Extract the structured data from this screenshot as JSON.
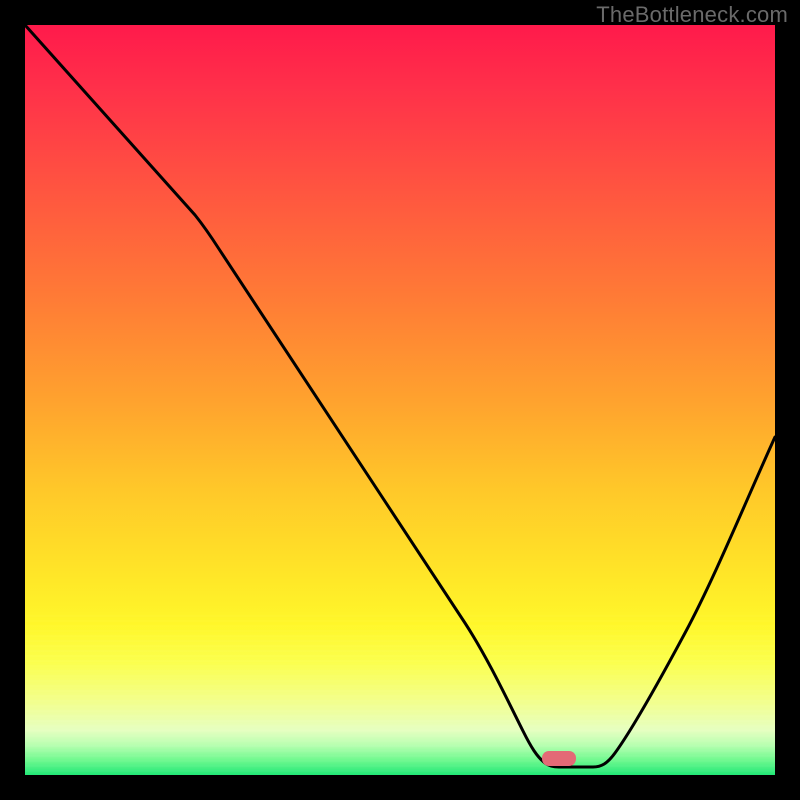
{
  "watermark": {
    "text": "TheBottleneck.com"
  },
  "chart_data": {
    "type": "line",
    "title": "",
    "xlabel": "",
    "ylabel": "",
    "xlim": [
      0,
      100
    ],
    "ylim": [
      0,
      100
    ],
    "x": [
      0,
      12,
      23,
      30,
      40,
      50,
      60,
      64,
      68,
      72,
      76,
      80,
      85,
      90,
      95,
      100
    ],
    "values": [
      100,
      86,
      75,
      68,
      55,
      42,
      27,
      17,
      8,
      3,
      1,
      2,
      9,
      22,
      38,
      56
    ],
    "gradient_colors": {
      "top": "#ff1a4b",
      "mid_upper": "#ff7a36",
      "mid": "#ffc829",
      "mid_lower": "#f3ff8a",
      "bottom": "#22e877"
    },
    "marker": {
      "x_pct": 71,
      "y_pct": 1.5,
      "color": "#e36a76"
    },
    "grid": false,
    "legend": false,
    "notes": "Background is a vertical red→orange→yellow→green gradient; black V-shaped curve reaches minimum near x≈72%."
  }
}
